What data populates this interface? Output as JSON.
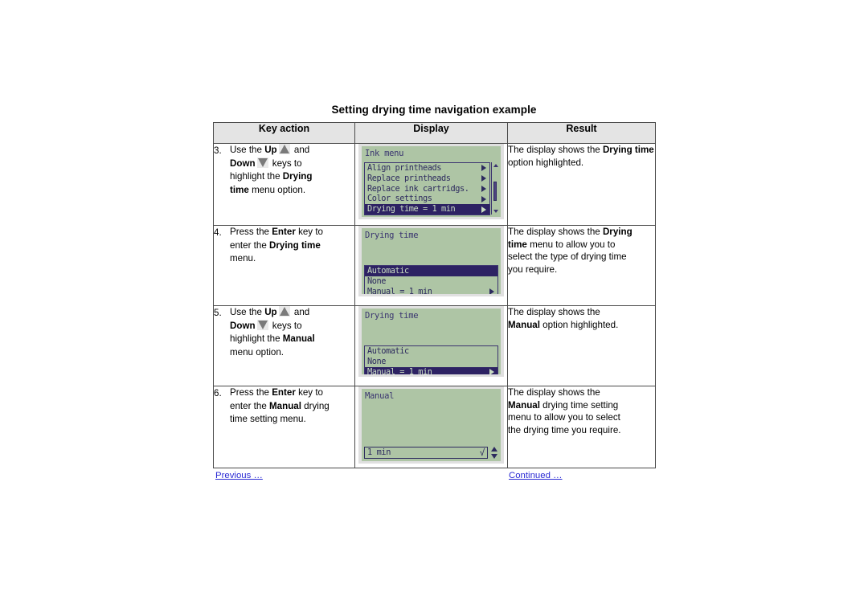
{
  "document": {
    "title": "Setting drying time navigation example"
  },
  "table": {
    "headers": [
      "Key action",
      "Display",
      "Result"
    ],
    "rows": [
      {
        "number": "3.",
        "key_action": {
          "segments": [
            {
              "text": "Use the ",
              "bold": false
            },
            {
              "text": "Up",
              "bold": true
            },
            {
              "icon": "triangle-up-icon"
            },
            {
              "text": " and ",
              "bold": false
            },
            {
              "break": true
            },
            {
              "text": "Down",
              "bold": true
            },
            {
              "icon": "triangle-down-icon"
            },
            {
              "text": " keys to ",
              "bold": false
            },
            {
              "break": true
            },
            {
              "text": "highlight the ",
              "bold": false
            },
            {
              "text": "Drying",
              "bold": true
            },
            {
              "break": true
            },
            {
              "text": "time",
              "bold": true
            },
            {
              "text": " menu option.",
              "bold": false
            }
          ]
        },
        "display": {
          "screen_title": "Ink menu",
          "has_scrollbar": true,
          "items": [
            {
              "label": "Align printheads",
              "arrow": true,
              "selected": false
            },
            {
              "label": "Replace printheads",
              "arrow": true,
              "selected": false
            },
            {
              "label": "Replace ink cartridgs.",
              "arrow": true,
              "selected": false
            },
            {
              "label": "Color settings",
              "arrow": true,
              "selected": false
            },
            {
              "label": "Drying time = 1 min",
              "arrow": true,
              "selected": true
            }
          ]
        },
        "result": {
          "segments": [
            {
              "text": "The display shows the ",
              "bold": false
            },
            {
              "text": "Drying",
              "bold": true
            },
            {
              "text": " ",
              "bold": false
            },
            {
              "text": "time",
              "bold": true
            },
            {
              "text": " option highlighted.",
              "bold": false
            }
          ]
        }
      },
      {
        "number": "4.",
        "key_action": {
          "segments": [
            {
              "text": "Press the ",
              "bold": false
            },
            {
              "text": "Enter",
              "bold": true
            },
            {
              "text": " key to ",
              "bold": false
            },
            {
              "break": true
            },
            {
              "text": "enter the ",
              "bold": false
            },
            {
              "text": "Drying time",
              "bold": true
            },
            {
              "break": true
            },
            {
              "text": "menu.",
              "bold": false
            }
          ]
        },
        "display": {
          "screen_title": "Drying time",
          "has_scrollbar": false,
          "items": [
            {
              "label": "Automatic",
              "arrow": false,
              "selected": true
            },
            {
              "label": "None",
              "arrow": false,
              "selected": false
            },
            {
              "label": "Manual = 1 min",
              "arrow": true,
              "selected": false
            }
          ]
        },
        "result": {
          "segments": [
            {
              "text": "The display shows the ",
              "bold": false
            },
            {
              "text": "Drying",
              "bold": true
            },
            {
              "break": true
            },
            {
              "text": "time",
              "bold": true
            },
            {
              "text": " menu to allow you to ",
              "bold": false
            },
            {
              "break": true
            },
            {
              "text": "select the type of drying time ",
              "bold": false
            },
            {
              "break": true
            },
            {
              "text": "you require.",
              "bold": false
            }
          ]
        }
      },
      {
        "number": "5.",
        "key_action": {
          "segments": [
            {
              "text": "Use the ",
              "bold": false
            },
            {
              "text": "Up",
              "bold": true
            },
            {
              "icon": "triangle-up-icon"
            },
            {
              "text": " and ",
              "bold": false
            },
            {
              "break": true
            },
            {
              "text": "Down",
              "bold": true
            },
            {
              "icon": "triangle-down-icon"
            },
            {
              "text": " keys to ",
              "bold": false
            },
            {
              "break": true
            },
            {
              "text": "highlight the ",
              "bold": false
            },
            {
              "text": "Manual",
              "bold": true
            },
            {
              "break": true
            },
            {
              "text": "menu option.",
              "bold": false
            }
          ]
        },
        "display": {
          "screen_title": "Drying time",
          "has_scrollbar": false,
          "items": [
            {
              "label": "Automatic",
              "arrow": false,
              "selected": false
            },
            {
              "label": "None",
              "arrow": false,
              "selected": false
            },
            {
              "label": "Manual = 1 min",
              "arrow": true,
              "selected": true
            }
          ]
        },
        "result": {
          "segments": [
            {
              "text": "The display shows the ",
              "bold": false
            },
            {
              "break": true
            },
            {
              "text": "Manual",
              "bold": true
            },
            {
              "text": " option highlighted.",
              "bold": false
            }
          ]
        }
      },
      {
        "number": "6.",
        "key_action": {
          "segments": [
            {
              "text": "Press the ",
              "bold": false
            },
            {
              "text": "Enter",
              "bold": true
            },
            {
              "text": " key to ",
              "bold": false
            },
            {
              "break": true
            },
            {
              "text": "enter the ",
              "bold": false
            },
            {
              "text": "Manual",
              "bold": true
            },
            {
              "text": " drying ",
              "bold": false
            },
            {
              "break": true
            },
            {
              "text": "time setting menu.",
              "bold": false
            }
          ]
        },
        "display": {
          "screen_title": "Manual",
          "has_scrollbar": false,
          "field": {
            "value": "1 min",
            "check_glyph": "√",
            "spinner": "up-down-spinner-icon"
          },
          "items": []
        },
        "result": {
          "segments": [
            {
              "text": "The display shows the ",
              "bold": false
            },
            {
              "break": true
            },
            {
              "text": "Manual",
              "bold": true
            },
            {
              "text": " drying time setting ",
              "bold": false
            },
            {
              "break": true
            },
            {
              "text": "menu to allow you to select ",
              "bold": false
            },
            {
              "break": true
            },
            {
              "text": "the drying time you require.",
              "bold": false
            }
          ]
        }
      }
    ]
  },
  "footer": {
    "previous_label": "Previous …",
    "continued_label": "Continued …"
  },
  "colors": {
    "lcd_background": "#aec5a5",
    "lcd_text": "#2d2a5e",
    "lcd_selected_background": "#2d2263",
    "lcd_selected_text": "#c9dcc2",
    "lcd_bezel": "#e0e0e0",
    "header_background": "#e4e4e4",
    "table_border": "#4a4a4a",
    "link": "#2b2bd4",
    "key_triangle": "#7a7a7a",
    "key_triangle_pad": "#e9e9e9"
  }
}
